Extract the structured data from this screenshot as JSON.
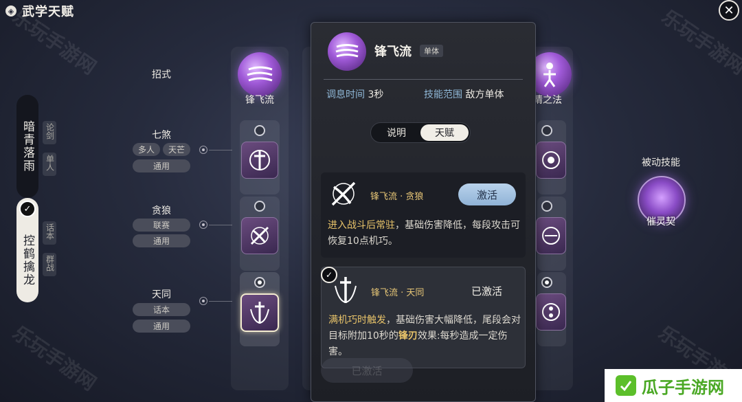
{
  "header": {
    "title": "武学天赋",
    "title_icon": "gear-diamond-icon",
    "close_icon": "close-x-icon"
  },
  "watermarks": [
    "乐玩手游网",
    "乐玩手游网",
    "乐玩手游网",
    "乐玩手游网"
  ],
  "schools": [
    {
      "name": "暗青落雨",
      "modes": [
        "论剑",
        "单人"
      ],
      "selected": false
    },
    {
      "name": "控鹤擒龙",
      "modes": [
        "话本",
        "群战"
      ],
      "selected": true
    }
  ],
  "rows": [
    {
      "label": "招式"
    },
    {
      "label": "七煞",
      "tags": [
        "多人",
        "天芒",
        "通用"
      ]
    },
    {
      "label": "贪狼",
      "tags": [
        "联赛",
        "通用"
      ]
    },
    {
      "label": "天同",
      "tags": [
        "话本",
        "通用"
      ]
    }
  ],
  "skills": [
    {
      "name": "锋飞流"
    },
    {
      "name": "睛之法"
    }
  ],
  "passive": {
    "title": "被动技能",
    "name": "催灵契"
  },
  "popup": {
    "skill_name": "锋飞流",
    "badge": "单体",
    "stats": [
      {
        "key": "调息时间",
        "value": "3秒"
      },
      {
        "key": "技能范围",
        "value": "敌方单体"
      }
    ],
    "tabs": [
      "说明",
      "天赋"
    ],
    "active_tab": "天赋",
    "talents": [
      {
        "name": "锋飞流 · 贪狼",
        "action": "激活",
        "desc_hl": "进入战斗后常驻",
        "desc_rest": "，基础伤害降低，每段攻击可恢复10点机巧。"
      },
      {
        "name": "锋飞流 · 天同",
        "action": "已激活",
        "desc_hl": "满机巧时触发",
        "desc_mid": "，基础伤害大幅降低，尾段会对目标附加10秒的",
        "desc_key": "锋刃",
        "desc_end": "效果:每秒造成一定伤害。"
      }
    ],
    "ghost_button": "已激活"
  },
  "brand": {
    "text": "瓜子手游网"
  },
  "colors": {
    "accent_gold": "#e9c46a",
    "accent_blue": "#a9c6e4",
    "purple": "#a05ad8"
  }
}
